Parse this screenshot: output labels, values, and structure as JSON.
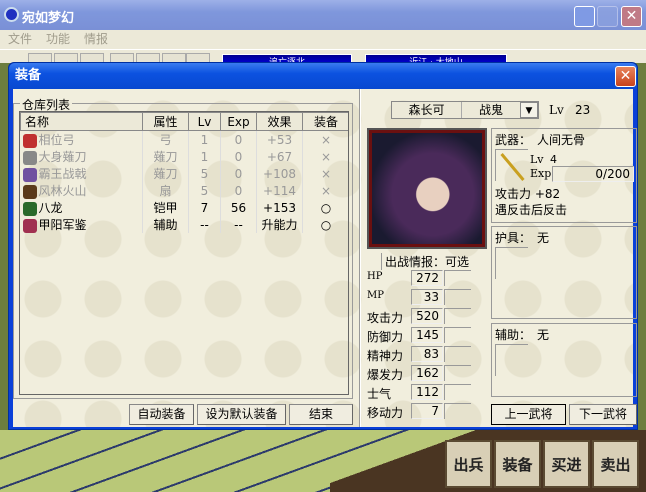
{
  "app": {
    "title": "宛如梦幻",
    "menu": [
      "文件",
      "功能",
      "情报"
    ],
    "banners": [
      "追亡逐北",
      "近江 · 大地山"
    ]
  },
  "dialog": {
    "title": "装备",
    "inventory": {
      "label": "仓库列表",
      "columns": [
        "名称",
        "属性",
        "Lv",
        "Exp",
        "效果",
        "装备"
      ],
      "rows": [
        {
          "name": "相位弓",
          "type": "弓",
          "lv": "1",
          "exp": "0",
          "effect": "+53",
          "equip": "×",
          "dim": true,
          "icon": "bow-icon"
        },
        {
          "name": "大身薙刀",
          "type": "薙刀",
          "lv": "1",
          "exp": "0",
          "effect": "+67",
          "equip": "×",
          "dim": true,
          "icon": "naginata-icon"
        },
        {
          "name": "霸王战戟",
          "type": "薙刀",
          "lv": "5",
          "exp": "0",
          "effect": "+108",
          "equip": "×",
          "dim": true,
          "icon": "halberd-icon"
        },
        {
          "name": "风林火山",
          "type": "扇",
          "lv": "5",
          "exp": "0",
          "effect": "+114",
          "equip": "×",
          "dim": true,
          "icon": "fan-icon"
        },
        {
          "name": "八龙",
          "type": "铠甲",
          "lv": "7",
          "exp": "56",
          "effect": "+153",
          "equip": "○",
          "dim": false,
          "icon": "armor-icon"
        },
        {
          "name": "甲阳军鉴",
          "type": "辅助",
          "lv": "--",
          "exp": "--",
          "effect": "升能力",
          "equip": "○",
          "dim": false,
          "icon": "book-icon"
        }
      ]
    },
    "buttons": {
      "auto": "自动装备",
      "default": "设为默认装备",
      "end": "结束",
      "prev": "上一武将",
      "next": "下一武将"
    },
    "character": {
      "name": "森长可",
      "class": "战鬼",
      "lv_label": "Lv",
      "lv": "23",
      "sortie": "出战情报：可选"
    },
    "stats": [
      {
        "label": "HP",
        "value": "272"
      },
      {
        "label": "MP",
        "value": "33"
      },
      {
        "label": "攻击力",
        "value": "520"
      },
      {
        "label": "防御力",
        "value": "145"
      },
      {
        "label": "精神力",
        "value": "83"
      },
      {
        "label": "爆发力",
        "value": "162"
      },
      {
        "label": "士气",
        "value": "112"
      },
      {
        "label": "移动力",
        "value": "7"
      }
    ],
    "weapon": {
      "label": "武器：",
      "name": "人间无骨",
      "lv_label": "Lv",
      "lv": "4",
      "exp_label": "Exp",
      "exp": "0/200",
      "attack": "攻击力 +82",
      "skill": "遇反击后反击"
    },
    "armor": {
      "label": "护具：",
      "name": "无"
    },
    "aux": {
      "label": "辅助：",
      "name": "无"
    }
  },
  "game_buttons": [
    "出兵",
    "装备",
    "买进",
    "卖出"
  ]
}
